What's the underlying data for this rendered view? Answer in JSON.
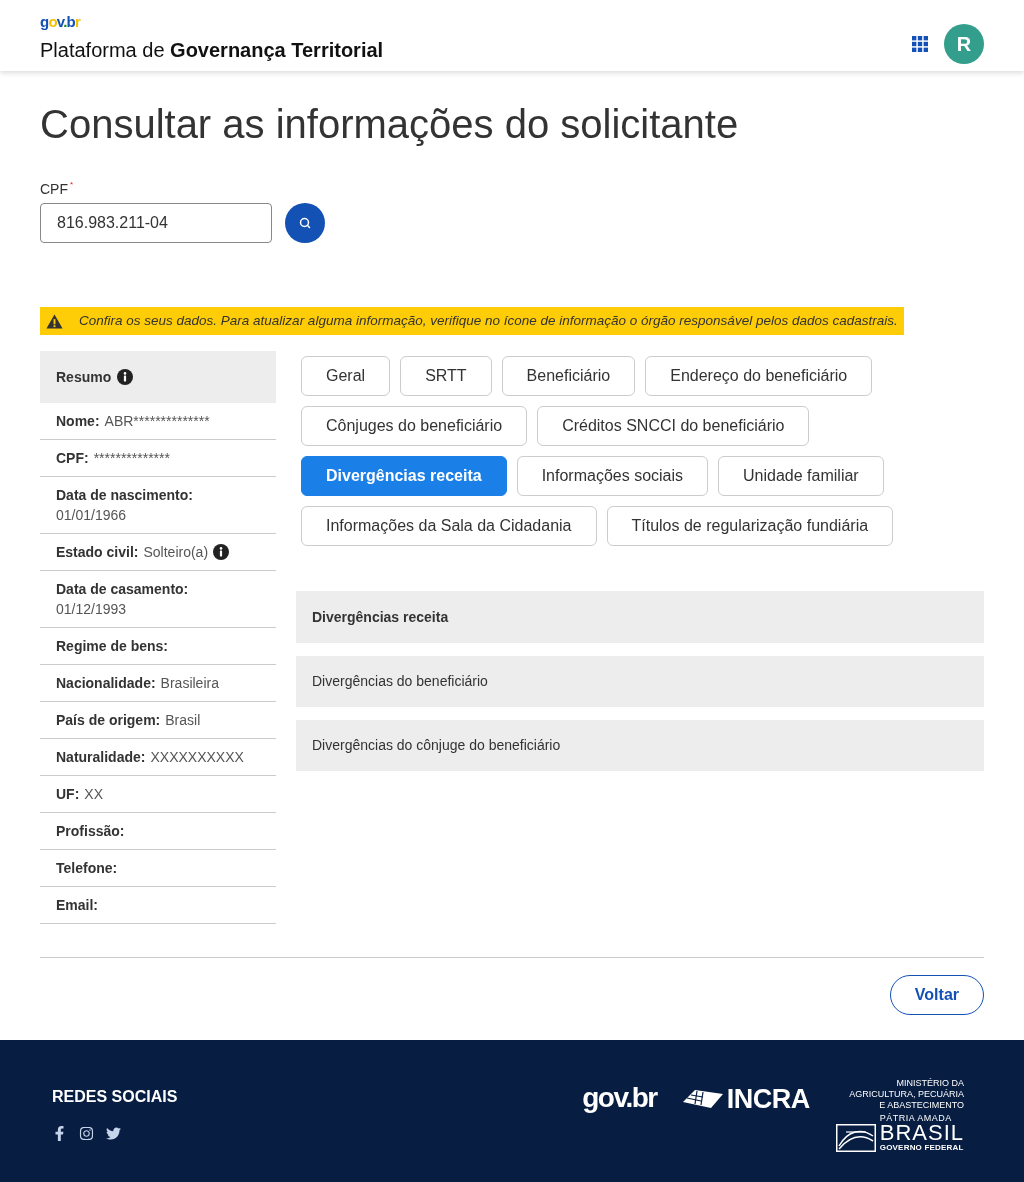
{
  "header": {
    "logo": "gov.br",
    "title": "Plataforma de **Governança Territorial**",
    "avatar_initial": "R"
  },
  "page_title": "Consultar as informações do solicitante",
  "cpf_field": {
    "label": "CPF",
    "required_mark": "*",
    "value": "816.983.211-04"
  },
  "alert": {
    "kind": "warning",
    "text": "Confira os seus dados. Para atualizar alguma informação, verifique no ícone de informação o órgão responsável pelos dados cadastrais."
  },
  "summary": {
    "title": "Resumo",
    "info": true,
    "rows": [
      {
        "kind": "inline",
        "label": "Nome:",
        "value": "ABR**************",
        "info": false
      },
      {
        "kind": "inline",
        "label": "CPF:",
        "value": "**************",
        "info": false
      },
      {
        "kind": "stacked",
        "label": "Data de nascimento:",
        "value": "01/01/1966",
        "info": false
      },
      {
        "kind": "inline",
        "label": "Estado civil:",
        "value": "Solteiro(a)",
        "info": true
      },
      {
        "kind": "stacked",
        "label": "Data de casamento:",
        "value": "01/12/1993",
        "info": false
      },
      {
        "kind": "inline",
        "label": "Regime de bens:",
        "info": false
      },
      {
        "kind": "inline",
        "label": "Nacionalidade:",
        "value": "Brasileira",
        "info": false
      },
      {
        "kind": "inline",
        "label": "País de origem:",
        "value": "Brasil",
        "info": false
      },
      {
        "kind": "inline",
        "label": "Naturalidade:",
        "value": "XXXXXXXXXX",
        "info": false
      },
      {
        "kind": "inline",
        "label": "UF:",
        "value": "XX",
        "info": false
      },
      {
        "kind": "inline",
        "label": "Profissão:",
        "info": false
      },
      {
        "kind": "inline",
        "label": "Telefone:",
        "info": false
      },
      {
        "kind": "inline",
        "label": "Email:",
        "info": false
      }
    ]
  },
  "tabs": [
    {
      "label": "Geral",
      "selected": false
    },
    {
      "label": "SRTT",
      "selected": false
    },
    {
      "label": "Beneficiário",
      "selected": false
    },
    {
      "label": "Endereço do beneficiário",
      "selected": false
    },
    {
      "label": "Cônjuges do beneficiário",
      "selected": false
    },
    {
      "label": "Créditos SNCCI do beneficiário",
      "selected": false
    },
    {
      "label": "Divergências receita",
      "selected": true
    },
    {
      "label": "Informações sociais",
      "selected": false
    },
    {
      "label": "Unidade familiar",
      "selected": false
    },
    {
      "label": "Informações da Sala da Cidadania",
      "selected": false
    },
    {
      "label": "Títulos de regularização fundiária",
      "selected": false
    }
  ],
  "section": {
    "title": "Divergências receita",
    "items": [
      {
        "label": "Divergências do beneficiário"
      },
      {
        "label": "Divergências do cônjuge do beneficiário"
      }
    ]
  },
  "back_button": "Voltar",
  "footer": {
    "social_title": "REDES SOCIAIS",
    "social_links": [
      {
        "kind": "facebook"
      },
      {
        "kind": "instagram"
      },
      {
        "kind": "twitter"
      }
    ],
    "logos": [
      {
        "kind": "govbr",
        "text": "gov.br"
      },
      {
        "kind": "incra",
        "text": "INCRA"
      },
      {
        "kind": "ministry",
        "lines": [
          "MINISTÉRIO DA",
          "AGRICULTURA, PECUÁRIA",
          "E ABASTECIMENTO"
        ],
        "motto": "PÁTRIA AMADA",
        "country": "BRASIL",
        "subtitle": "GOVERNO FEDERAL"
      }
    ]
  }
}
